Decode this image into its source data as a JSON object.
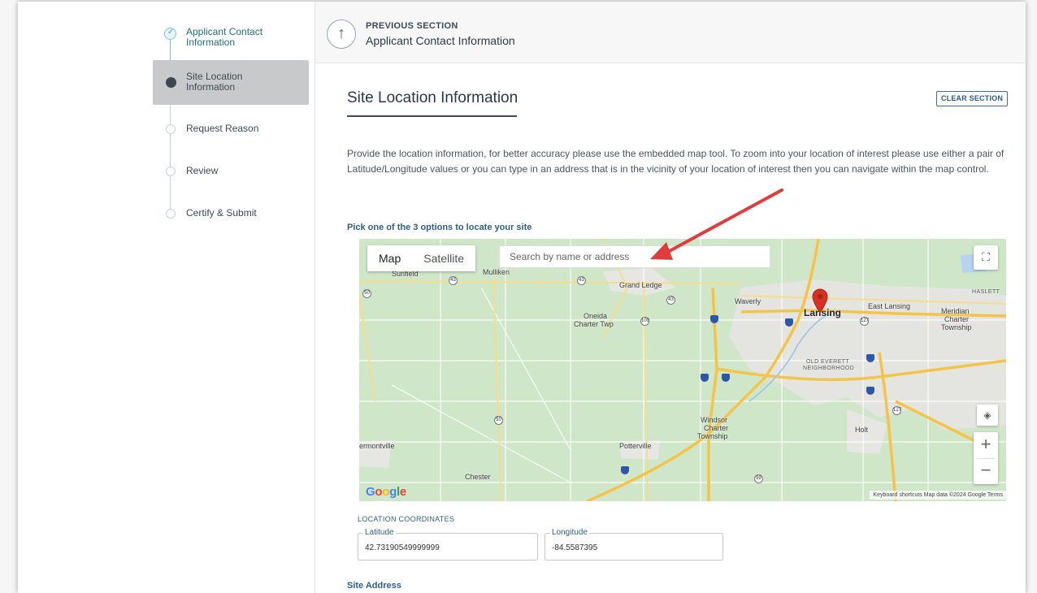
{
  "sidebar": {
    "steps": [
      {
        "label_line1": "Applicant Contact",
        "label_line2": "Information",
        "state": "done"
      },
      {
        "label_line1": "Site Location",
        "label_line2": "Information",
        "state": "active"
      },
      {
        "label_line1": "Request Reason",
        "label_line2": "",
        "state": "todo"
      },
      {
        "label_line1": "Review",
        "label_line2": "",
        "state": "todo"
      },
      {
        "label_line1": "Certify & Submit",
        "label_line2": "",
        "state": "todo"
      }
    ]
  },
  "header": {
    "kicker": "PREVIOUS SECTION",
    "title": "Applicant Contact Information",
    "icon": "arrow-up-circle-icon"
  },
  "section": {
    "title": "Site Location Information",
    "clear_label": "CLEAR SECTION",
    "description": "Provide the location information, for better accuracy please use the embedded map tool. To zoom into your location of interest please use either a pair of Latitude/Longitude values or you can type in an address that is in the vicinity of your location of interest then you can navigate within the map control.",
    "pick_label": "Pick one of the 3 options to locate your site"
  },
  "map": {
    "type_map": "Map",
    "type_satellite": "Satellite",
    "search_placeholder": "Search by name or address",
    "zoom_in": "+",
    "zoom_out": "−",
    "brand": "Google",
    "attribution": "Keyboard shortcuts   Map data ©2024 Google   Terms",
    "places": {
      "sunfield": "Sunfield",
      "mulliken": "Mulliken",
      "grand_ledge": "Grand Ledge",
      "waverly": "Waverly",
      "lansing": "Lansing",
      "east_lansing": "East Lansing",
      "haslett": "HASLETT",
      "meridian1": "Meridian",
      "meridian2": "Charter",
      "meridian3": "Township",
      "oneida1": "Oneida",
      "oneida2": "Charter Twp",
      "old_everett1": "OLD EVERETT",
      "old_everett2": "NEIGHBORHOOD",
      "windsor1": "Windsor",
      "windsor2": "Charter",
      "windsor3": "Township",
      "holt": "Holt",
      "potterville": "Potterville",
      "vermontville": "ermontville",
      "chester": "Chester"
    },
    "routes": {
      "r43a": "43",
      "r43b": "43",
      "r43c": "43",
      "r50a": "50",
      "r50b": "50",
      "r100": "100",
      "r127a": "127",
      "r127b": "127",
      "r99": "99"
    },
    "colors": {
      "land": "#cfe6c9",
      "urban": "#e6e6e3",
      "highway": "#f4c44a",
      "road": "#ffffff",
      "pin": "#d93025"
    }
  },
  "coordinates": {
    "heading": "LOCATION COORDINATES",
    "latitude_label": "Latitude",
    "latitude_value": "42.73190549999999",
    "longitude_label": "Longitude",
    "longitude_value": "-84.5587395"
  },
  "site_address": {
    "label": "Site Address"
  },
  "colors": {
    "accent": "#2f5f87",
    "annotation_arrow": "#e03c3c",
    "active_step_bg": "#c8c9cb"
  }
}
